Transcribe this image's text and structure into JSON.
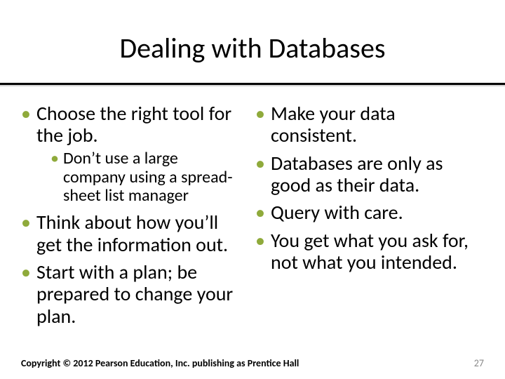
{
  "title": "Dealing with Databases",
  "left": {
    "items": [
      {
        "text": "Choose the right tool for the job.",
        "sub": [
          {
            "text": "Don’t use a large company using a spread-sheet list manager"
          }
        ]
      },
      {
        "text": "Think about how you’ll get the information out."
      },
      {
        "text": "Start with a plan; be prepared to change your plan."
      }
    ]
  },
  "right": {
    "items": [
      {
        "text": "Make your data consistent."
      },
      {
        "text": "Databases are only as good as their data."
      },
      {
        "text": "Query with care."
      },
      {
        "text": "You get what you ask for, not what you intended."
      }
    ]
  },
  "footer": "Copyright © 2012 Pearson Education, Inc. publishing as Prentice Hall",
  "pageNumber": "27"
}
